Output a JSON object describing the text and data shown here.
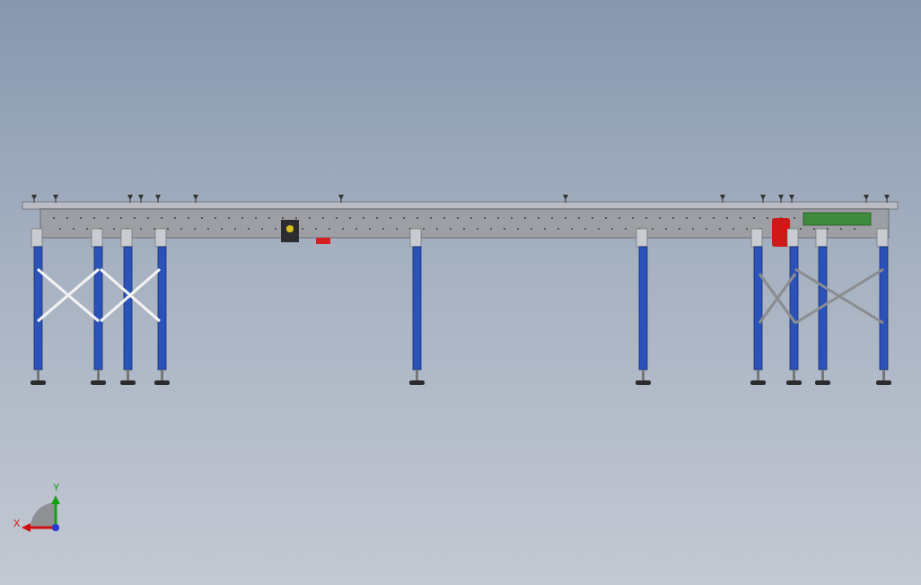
{
  "viewport": {
    "triad": {
      "x_label": "X",
      "y_label": "Y"
    }
  }
}
